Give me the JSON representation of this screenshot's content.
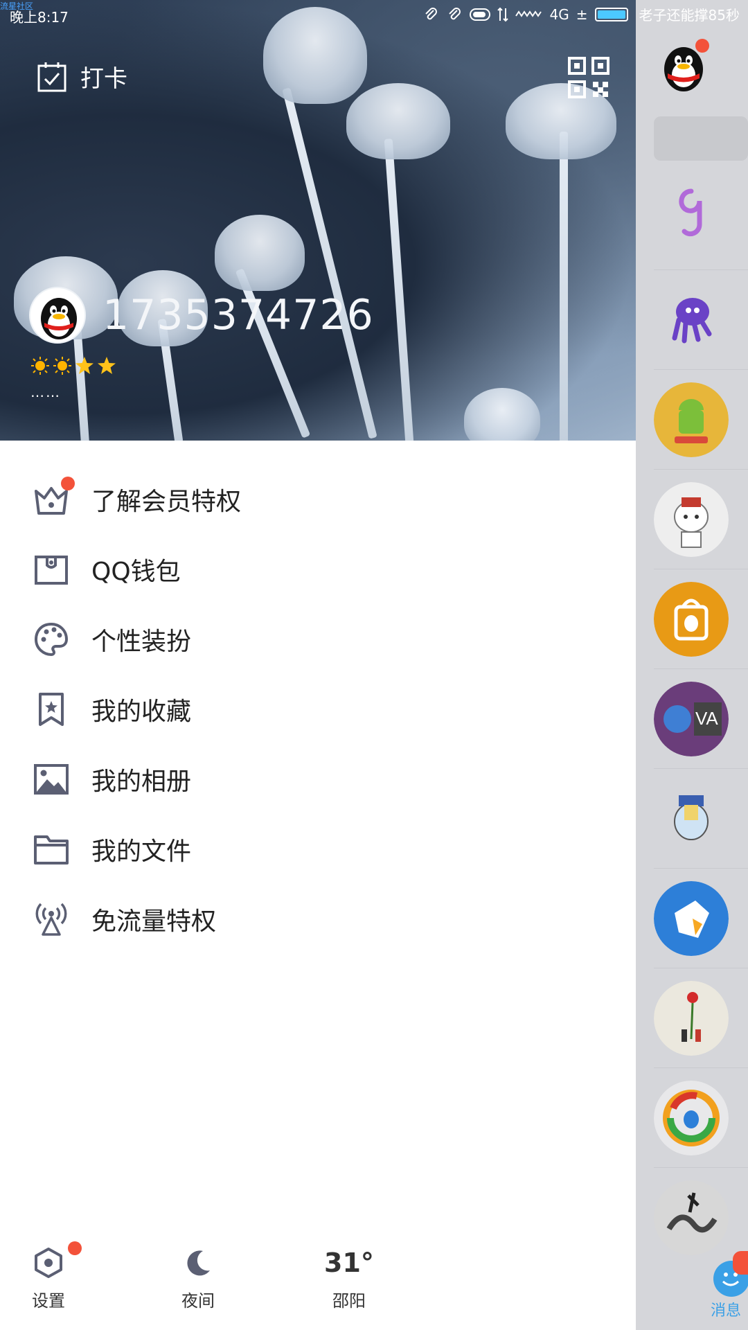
{
  "status_bar": {
    "watermark": "流星社区",
    "time": "晚上8:17",
    "network": "4G",
    "battery_text": "老子还能撑85秒"
  },
  "header": {
    "checkin_label": "打卡",
    "qq_number": "1735374726",
    "signature": "……",
    "level_icons": [
      "sun",
      "sun",
      "star",
      "star"
    ]
  },
  "menu": {
    "items": [
      {
        "label": "了解会员特权",
        "icon": "crown-icon",
        "badge": true
      },
      {
        "label": "QQ钱包",
        "icon": "wallet-icon",
        "badge": false
      },
      {
        "label": "个性装扮",
        "icon": "palette-icon",
        "badge": false
      },
      {
        "label": "我的收藏",
        "icon": "bookmark-star-icon",
        "badge": false
      },
      {
        "label": "我的相册",
        "icon": "image-icon",
        "badge": false
      },
      {
        "label": "我的文件",
        "icon": "folder-icon",
        "badge": false
      },
      {
        "label": "免流量特权",
        "icon": "antenna-icon",
        "badge": false
      }
    ]
  },
  "bottom": {
    "settings_label": "设置",
    "night_label": "夜间",
    "weather_temp": "31°",
    "weather_city": "邵阳"
  },
  "side_strip": {
    "message_tab_label": "消息"
  },
  "colors": {
    "accent_blue": "#3aa0e6",
    "badge_red": "#f3523a",
    "icon_gray": "#5b5f73"
  }
}
